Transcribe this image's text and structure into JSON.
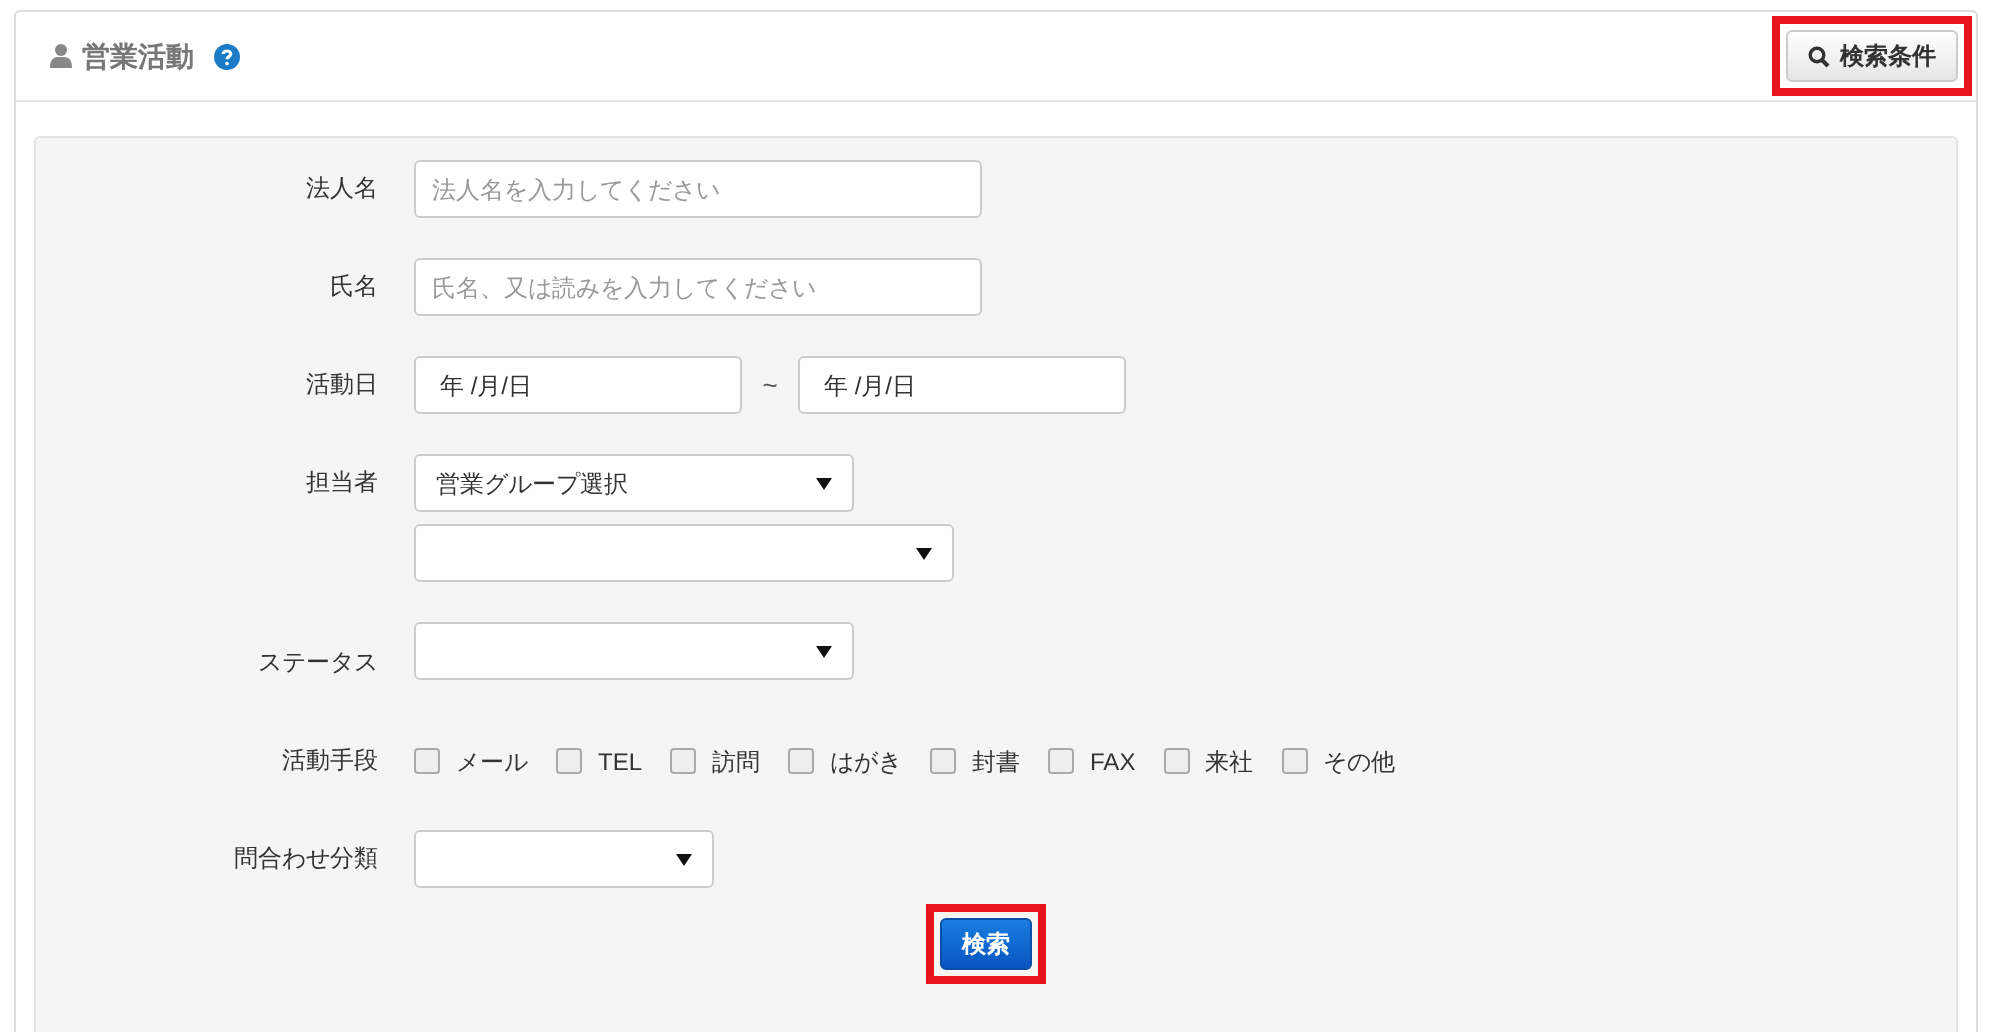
{
  "header": {
    "title": "営業活動",
    "search_toggle": {
      "label": "検索条件",
      "highlighted": true
    }
  },
  "fields": [
    {
      "kind": "text",
      "label": "法人名",
      "placeholder": "法人名を入力してください"
    },
    {
      "kind": "text",
      "label": "氏名",
      "placeholder": "氏名、又は読みを入力してください"
    },
    {
      "kind": "date_range",
      "label": "活動日",
      "from": "年 /月/日",
      "separator": "~",
      "to": "年 /月/日"
    },
    {
      "kind": "select_pair",
      "label": "担当者",
      "first": "営業グループ選択"
    },
    {
      "kind": "select",
      "label": "ステータス"
    },
    {
      "kind": "checkboxes",
      "label": "活動手段",
      "options": [
        {
          "label": "メール",
          "checked": false
        },
        {
          "label": "TEL",
          "checked": false
        },
        {
          "label": "訪問",
          "checked": false
        },
        {
          "label": "はがき",
          "checked": false
        },
        {
          "label": "封書",
          "checked": false
        },
        {
          "label": "FAX",
          "checked": false
        },
        {
          "label": "来社",
          "checked": false
        },
        {
          "label": "その他",
          "checked": false
        }
      ]
    },
    {
      "kind": "short_select",
      "label": "問合わせ分類"
    }
  ],
  "submit": {
    "label": "検索",
    "highlighted": true
  }
}
